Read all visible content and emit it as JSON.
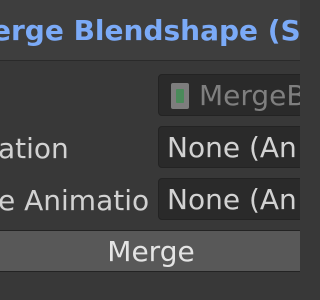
{
  "header": {
    "title": "erge Blendshape (Scr"
  },
  "rows": [
    {
      "label": "",
      "value": "MergeB",
      "icon": "gameobject-icon",
      "disabled": true
    },
    {
      "label": "ation",
      "value": "None (An"
    },
    {
      "label": "e Animatio",
      "value": "None (An"
    }
  ],
  "actions": {
    "merge_label": "Merge"
  },
  "colors": {
    "background": "#383838",
    "header_title": "#7baaf7",
    "field_bg": "#2a2a2a",
    "button_bg": "#585858"
  }
}
